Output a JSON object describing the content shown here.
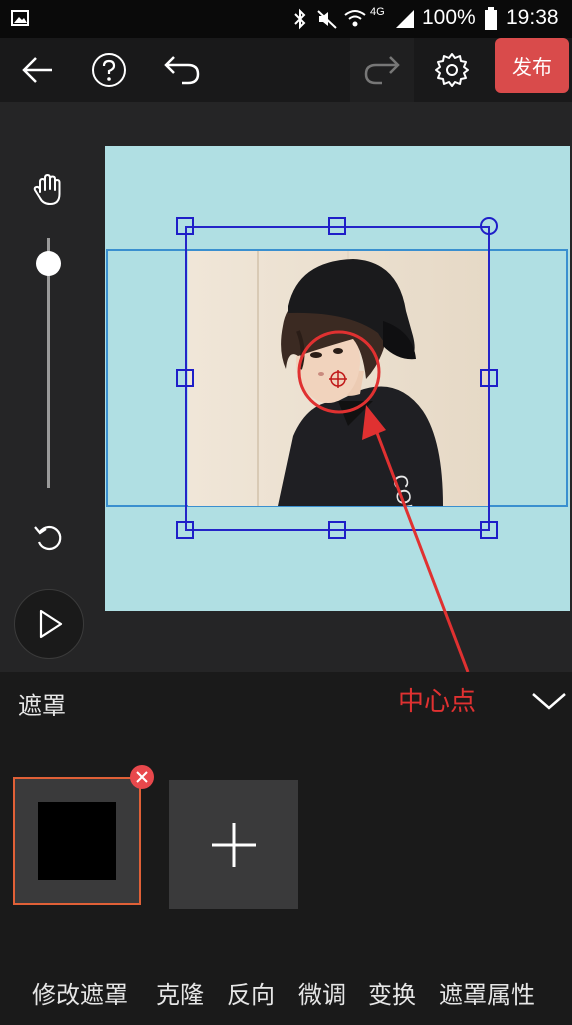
{
  "status_bar": {
    "battery": "100%",
    "time": "19:38",
    "network": "4G",
    "icons": [
      "gallery-icon",
      "bluetooth-icon",
      "mute-icon",
      "wifi-icon",
      "signal-icon",
      "battery-icon"
    ]
  },
  "toolbar": {
    "back_icon": "back-arrow-icon",
    "help_icon": "help-icon",
    "undo_icon": "undo-icon",
    "redo_icon": "redo-icon",
    "settings_icon": "gear-icon",
    "publish_label": "发布"
  },
  "colors": {
    "accent": "#d94b4b",
    "canvas_bg": "#b0dfe3",
    "selection": "#2424c8",
    "annotation": "#e03131"
  },
  "editor": {
    "hand_tool_icon": "hand-icon",
    "reset_icon": "rotate-icon",
    "play_icon": "play-icon",
    "zoom_level": 0.9
  },
  "annotation": {
    "label": "中心点"
  },
  "panel": {
    "title": "遮罩",
    "collapse_icon": "chevron-down-icon",
    "add_icon": "plus-icon",
    "delete_icon": "close-icon"
  },
  "bottom_menu": {
    "items": [
      "修改遮罩",
      "克隆",
      "反向",
      "微调",
      "变换",
      "遮罩属性"
    ]
  }
}
